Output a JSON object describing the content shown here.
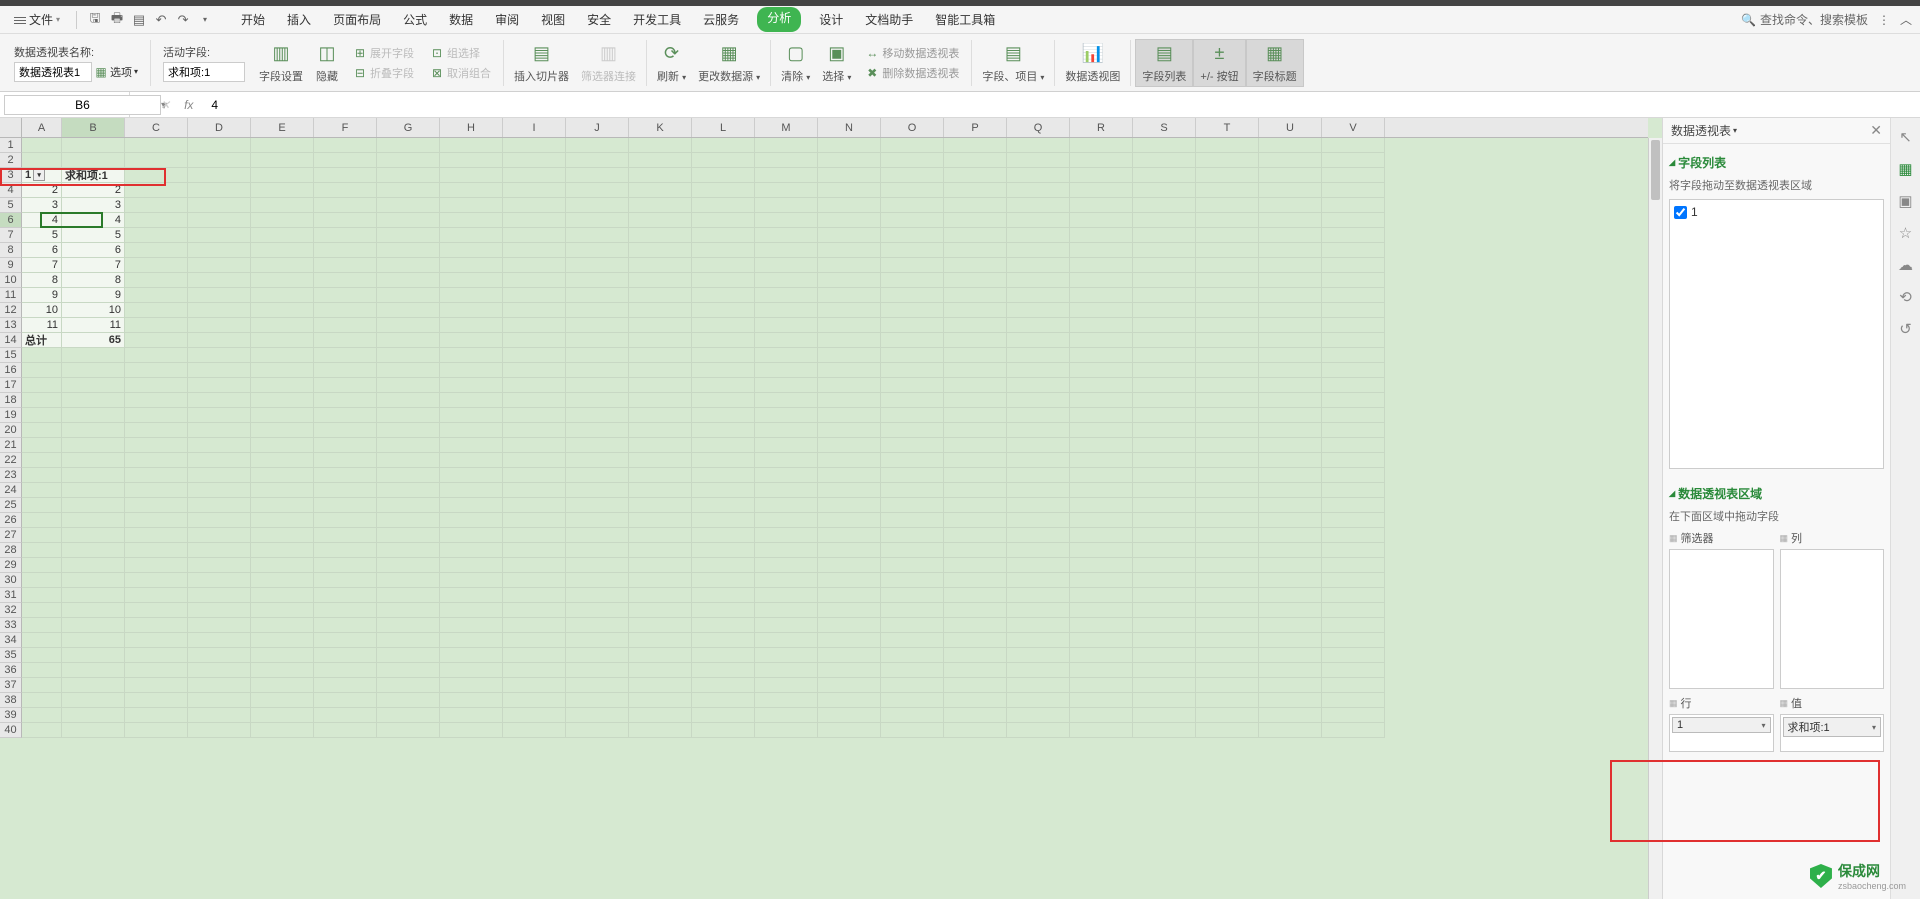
{
  "menu": {
    "file": "文件",
    "tabs": [
      "开始",
      "插入",
      "页面布局",
      "公式",
      "数据",
      "审阅",
      "视图",
      "安全",
      "开发工具",
      "云服务",
      "分析",
      "设计",
      "文档助手",
      "智能工具箱"
    ],
    "active_tab_index": 10,
    "search_placeholder": "查找命令、搜索模板"
  },
  "ribbon": {
    "pivot_name_label": "数据透视表名称:",
    "pivot_name_value": "数据透视表1",
    "options": "选项",
    "active_field_label": "活动字段:",
    "active_field_value": "求和项:1",
    "field_settings": "字段设置",
    "hide": "隐藏",
    "expand_field": "展开字段",
    "collapse_field": "折叠字段",
    "group_select": "组选择",
    "ungroup": "取消组合",
    "insert_slicer": "插入切片器",
    "filter_conn": "筛选器连接",
    "refresh": "刷新",
    "change_source": "更改数据源",
    "clear": "清除",
    "select": "选择",
    "move_pivot": "移动数据透视表",
    "delete_pivot": "删除数据透视表",
    "fields_items": "字段、项目",
    "pivot_chart": "数据透视图",
    "field_list": "字段列表",
    "plusminus": "+/- 按钮",
    "field_headers": "字段标题"
  },
  "formula_bar": {
    "name_box": "B6",
    "formula": "4"
  },
  "grid": {
    "columns": [
      "A",
      "B",
      "C",
      "D",
      "E",
      "F",
      "G",
      "H",
      "I",
      "J",
      "K",
      "L",
      "M",
      "N",
      "O",
      "P",
      "Q",
      "R",
      "S",
      "T",
      "U",
      "V"
    ],
    "active_col": "B",
    "active_row": 6,
    "rows_shown": 40,
    "pivot_header_a": "1",
    "pivot_header_b": "求和项:1",
    "total_label": "总计",
    "data": [
      {
        "a": "2",
        "b": "2"
      },
      {
        "a": "3",
        "b": "3"
      },
      {
        "a": "4",
        "b": "4"
      },
      {
        "a": "5",
        "b": "5"
      },
      {
        "a": "6",
        "b": "6"
      },
      {
        "a": "7",
        "b": "7"
      },
      {
        "a": "8",
        "b": "8"
      },
      {
        "a": "9",
        "b": "9"
      },
      {
        "a": "10",
        "b": "10"
      },
      {
        "a": "11",
        "b": "11"
      }
    ],
    "total_value": "65"
  },
  "panel": {
    "title": "数据透视表",
    "field_list_title": "字段列表",
    "field_list_hint": "将字段拖动至数据透视表区域",
    "fields": [
      {
        "name": "1",
        "checked": true
      }
    ],
    "areas_title": "数据透视表区域",
    "areas_hint": "在下面区域中拖动字段",
    "filter_label": "筛选器",
    "col_label": "列",
    "row_label": "行",
    "val_label": "值",
    "row_chips": [
      "1"
    ],
    "val_chips": [
      "求和项:1"
    ]
  },
  "watermark": {
    "brand": "保成网",
    "sub": "zsbaocheng.com"
  }
}
